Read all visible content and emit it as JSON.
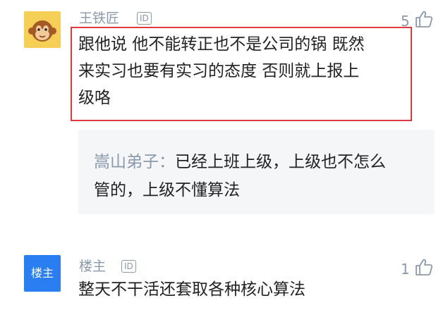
{
  "comment1": {
    "avatar_icon": "monkey-avatar-icon",
    "username": "王铁匠",
    "id_badge": "ID",
    "like_count": "5",
    "like_icon": "thumbs-up-icon",
    "text_lines": [
      "跟他说 他不能转正也不是公司的锅 既然",
      "来实习也要有实习的态度 否则就上报上",
      "级咯"
    ],
    "highlight_color": "#e03a3e"
  },
  "reply": {
    "author": "嵩山弟子：",
    "text_line1": "已经上班上级，上级也不怎么",
    "text_line2": "管的，上级不懂算法"
  },
  "comment2": {
    "avatar_label": "楼主",
    "username": "楼主",
    "id_badge": "ID",
    "like_count": "1",
    "like_icon": "thumbs-up-icon",
    "text": "整天不干活还套取各种核心算法"
  },
  "colors": {
    "meta_gray": "#8c99ab",
    "avatar_yellow": "#f6cf57",
    "avatar_blue": "#2b7df2",
    "reply_bg": "#f5f6f8"
  }
}
